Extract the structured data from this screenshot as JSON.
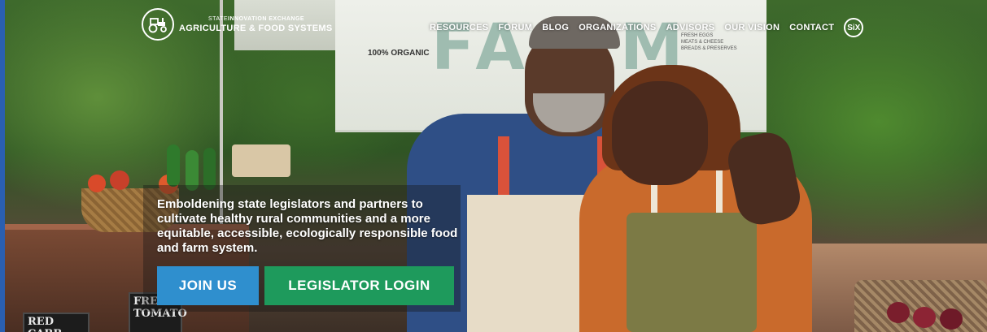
{
  "header": {
    "logo_top_prefix": "STATE",
    "logo_top": "INNOVATION EXCHANGE",
    "logo_title": "AGRICULTURE & FOOD SYSTEMS",
    "logo_icon": "tractor-icon"
  },
  "nav": {
    "items": [
      {
        "label": "RESOURCES"
      },
      {
        "label": "FORUM"
      },
      {
        "label": "BLOG"
      },
      {
        "label": "ORGANIZATIONS"
      },
      {
        "label": "ADVISORS"
      },
      {
        "label": "OUR VISION"
      },
      {
        "label": "CONTACT"
      }
    ],
    "badge": "SiX"
  },
  "banner": {
    "organic": "100% ORGANIC",
    "big_text": "FA  RM",
    "price_list": "FRESH EGGS\nMEATS & CHEESE\nBREADS & PRESERVES",
    "sub": "M"
  },
  "signs": {
    "left": "RED CABB",
    "right": "FRE TOMATO"
  },
  "hero": {
    "tagline": "Emboldening state legislators and partners to cultivate healthy rural communities and a more equitable, accessible, ecologically responsible food and farm system.",
    "join_label": "JOIN US",
    "login_label": "LEGISLATOR LOGIN"
  },
  "colors": {
    "join_button": "#2f8fce",
    "login_button": "#1e9a5c",
    "nav_text": "#ffffff"
  }
}
